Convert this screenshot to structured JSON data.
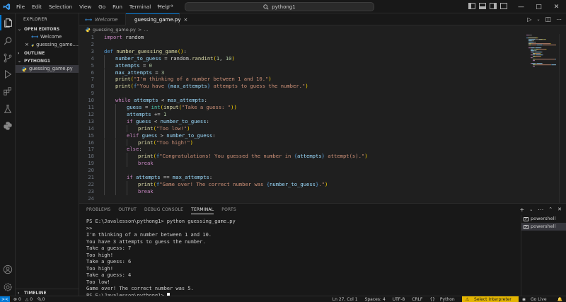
{
  "titlebar": {
    "menu": [
      "File",
      "Edit",
      "Selection",
      "View",
      "Go",
      "Run",
      "Terminal",
      "Help"
    ],
    "search_text": "pythong1"
  },
  "sidebar": {
    "header": "EXPLORER",
    "open_editors": {
      "title": "OPEN EDITORS",
      "items": [
        {
          "name": "Welcome",
          "icon": "vscode-icon"
        },
        {
          "name": "guessing_game....",
          "icon": "python-icon",
          "close": "×"
        }
      ]
    },
    "outline_title": "OUTLINE",
    "folder": {
      "title": "PYTHONG1",
      "files": [
        {
          "name": "guessing_game.py",
          "icon": "python-icon"
        }
      ]
    },
    "timeline_title": "TIMELINE"
  },
  "tabs": [
    {
      "label": "Welcome",
      "active": false
    },
    {
      "label": "guessing_game.py",
      "active": true,
      "close": "×"
    }
  ],
  "breadcrumb": {
    "file": "guessing_game.py",
    "sep": ">",
    "rest": "..."
  },
  "code": [
    {
      "n": "1",
      "indent": 0,
      "t": [
        [
          "kw",
          "import"
        ],
        [
          "op",
          " random"
        ]
      ]
    },
    {
      "n": "2",
      "indent": 0,
      "t": []
    },
    {
      "n": "3",
      "indent": 0,
      "t": [
        [
          "kb",
          "def "
        ],
        [
          "fn",
          "number_guessing_game"
        ],
        [
          "br",
          "()"
        ],
        [
          "op",
          ":"
        ]
      ]
    },
    {
      "n": "4",
      "indent": 1,
      "t": [
        [
          "va",
          "number_to_guess"
        ],
        [
          "op",
          " = random."
        ],
        [
          "fn",
          "randint"
        ],
        [
          "br",
          "("
        ],
        [
          "nu",
          "1"
        ],
        [
          "op",
          ", "
        ],
        [
          "nu",
          "10"
        ],
        [
          "br",
          ")"
        ]
      ]
    },
    {
      "n": "5",
      "indent": 1,
      "t": [
        [
          "va",
          "attempts"
        ],
        [
          "op",
          " = "
        ],
        [
          "nu",
          "0"
        ]
      ]
    },
    {
      "n": "6",
      "indent": 1,
      "t": [
        [
          "va",
          "max_attempts"
        ],
        [
          "op",
          " = "
        ],
        [
          "nu",
          "3"
        ]
      ]
    },
    {
      "n": "7",
      "indent": 1,
      "t": [
        [
          "fn",
          "print"
        ],
        [
          "br",
          "("
        ],
        [
          "st",
          "\"I'm thinking of a number between 1 and 10.\""
        ],
        [
          "br",
          ")"
        ]
      ]
    },
    {
      "n": "8",
      "indent": 1,
      "t": [
        [
          "fn",
          "print"
        ],
        [
          "br",
          "("
        ],
        [
          "kb",
          "f"
        ],
        [
          "st",
          "\"You have "
        ],
        [
          "kb",
          "{"
        ],
        [
          "va",
          "max_attempts"
        ],
        [
          "kb",
          "}"
        ],
        [
          "st",
          " attempts to guess the number.\""
        ],
        [
          "br",
          ")"
        ]
      ]
    },
    {
      "n": "9",
      "indent": 1,
      "t": []
    },
    {
      "n": "10",
      "indent": 1,
      "t": [
        [
          "kw",
          "while "
        ],
        [
          "va",
          "attempts"
        ],
        [
          "op",
          " < "
        ],
        [
          "va",
          "max_attempts"
        ],
        [
          "op",
          ":"
        ]
      ]
    },
    {
      "n": "11",
      "indent": 2,
      "t": [
        [
          "va",
          "guess"
        ],
        [
          "op",
          " = "
        ],
        [
          "bu",
          "int"
        ],
        [
          "br",
          "("
        ],
        [
          "fn",
          "input"
        ],
        [
          "br",
          "("
        ],
        [
          "st",
          "\"Take a guess: \""
        ],
        [
          "br",
          "))"
        ]
      ]
    },
    {
      "n": "12",
      "indent": 2,
      "t": [
        [
          "va",
          "attempts"
        ],
        [
          "op",
          " += "
        ],
        [
          "nu",
          "1"
        ]
      ]
    },
    {
      "n": "13",
      "indent": 2,
      "t": [
        [
          "kw",
          "if "
        ],
        [
          "va",
          "guess"
        ],
        [
          "op",
          " < "
        ],
        [
          "va",
          "number_to_guess"
        ],
        [
          "op",
          ":"
        ]
      ]
    },
    {
      "n": "14",
      "indent": 3,
      "t": [
        [
          "fn",
          "print"
        ],
        [
          "br",
          "("
        ],
        [
          "st",
          "\"Too low!\""
        ],
        [
          "br",
          ")"
        ]
      ]
    },
    {
      "n": "15",
      "indent": 2,
      "t": [
        [
          "kw",
          "elif "
        ],
        [
          "va",
          "guess"
        ],
        [
          "op",
          " > "
        ],
        [
          "va",
          "number_to_guess"
        ],
        [
          "op",
          ":"
        ]
      ]
    },
    {
      "n": "16",
      "indent": 3,
      "t": [
        [
          "fn",
          "print"
        ],
        [
          "br",
          "("
        ],
        [
          "st",
          "\"Too high!\""
        ],
        [
          "br",
          ")"
        ]
      ]
    },
    {
      "n": "17",
      "indent": 2,
      "t": [
        [
          "kw",
          "else"
        ],
        [
          "op",
          ":"
        ]
      ]
    },
    {
      "n": "18",
      "indent": 3,
      "t": [
        [
          "fn",
          "print"
        ],
        [
          "br",
          "("
        ],
        [
          "kb",
          "f"
        ],
        [
          "st",
          "\"Congratulations! You guessed the number in "
        ],
        [
          "kb",
          "{"
        ],
        [
          "va",
          "attempts"
        ],
        [
          "kb",
          "}"
        ],
        [
          "st",
          " attempt(s).\""
        ],
        [
          "br",
          ")"
        ]
      ]
    },
    {
      "n": "19",
      "indent": 3,
      "t": [
        [
          "kw",
          "break"
        ]
      ]
    },
    {
      "n": "20",
      "indent": 2,
      "t": []
    },
    {
      "n": "21",
      "indent": 2,
      "t": [
        [
          "kw",
          "if "
        ],
        [
          "va",
          "attempts"
        ],
        [
          "op",
          " == "
        ],
        [
          "va",
          "max_attempts"
        ],
        [
          "op",
          ":"
        ]
      ]
    },
    {
      "n": "22",
      "indent": 3,
      "t": [
        [
          "fn",
          "print"
        ],
        [
          "br",
          "("
        ],
        [
          "kb",
          "f"
        ],
        [
          "st",
          "\"Game over! The correct number was "
        ],
        [
          "kb",
          "{"
        ],
        [
          "va",
          "number_to_guess"
        ],
        [
          "kb",
          "}"
        ],
        [
          "st",
          ".\""
        ],
        [
          "br",
          ")"
        ]
      ]
    },
    {
      "n": "23",
      "indent": 3,
      "t": [
        [
          "kw",
          "break"
        ]
      ]
    },
    {
      "n": "24",
      "indent": 0,
      "t": []
    }
  ],
  "panel": {
    "tabs": [
      "PROBLEMS",
      "OUTPUT",
      "DEBUG CONSOLE",
      "TERMINAL",
      "PORTS"
    ],
    "active_tab": "TERMINAL",
    "terminal_lines": [
      "PS E:\\Javalesson\\pythong1> python guessing_game.py",
      ">>",
      "I'm thinking of a number between 1 and 10.",
      "You have 3 attempts to guess the number.",
      "Take a guess: 7",
      "Too high!",
      "Take a guess: 6",
      "Too high!",
      "Take a guess: 4",
      "Too low!",
      "Game over! The correct number was 5.",
      "PS E:\\Javalesson\\pythong1> "
    ],
    "terminals": [
      "powershell",
      "powershell"
    ]
  },
  "statusbar": {
    "errors": "0",
    "warnings": "0",
    "ports": "0",
    "position": "Ln 27, Col 1",
    "spaces": "Spaces: 4",
    "encoding": "UTF-8",
    "eol": "CRLF",
    "language": "Python",
    "interpreter": "Select Interpreter",
    "golive": "Go Live"
  },
  "colors": {
    "accent": "#0078d4",
    "warning_bg": "#e4b500",
    "bg": "#1f1f1f",
    "chrome": "#181818"
  }
}
